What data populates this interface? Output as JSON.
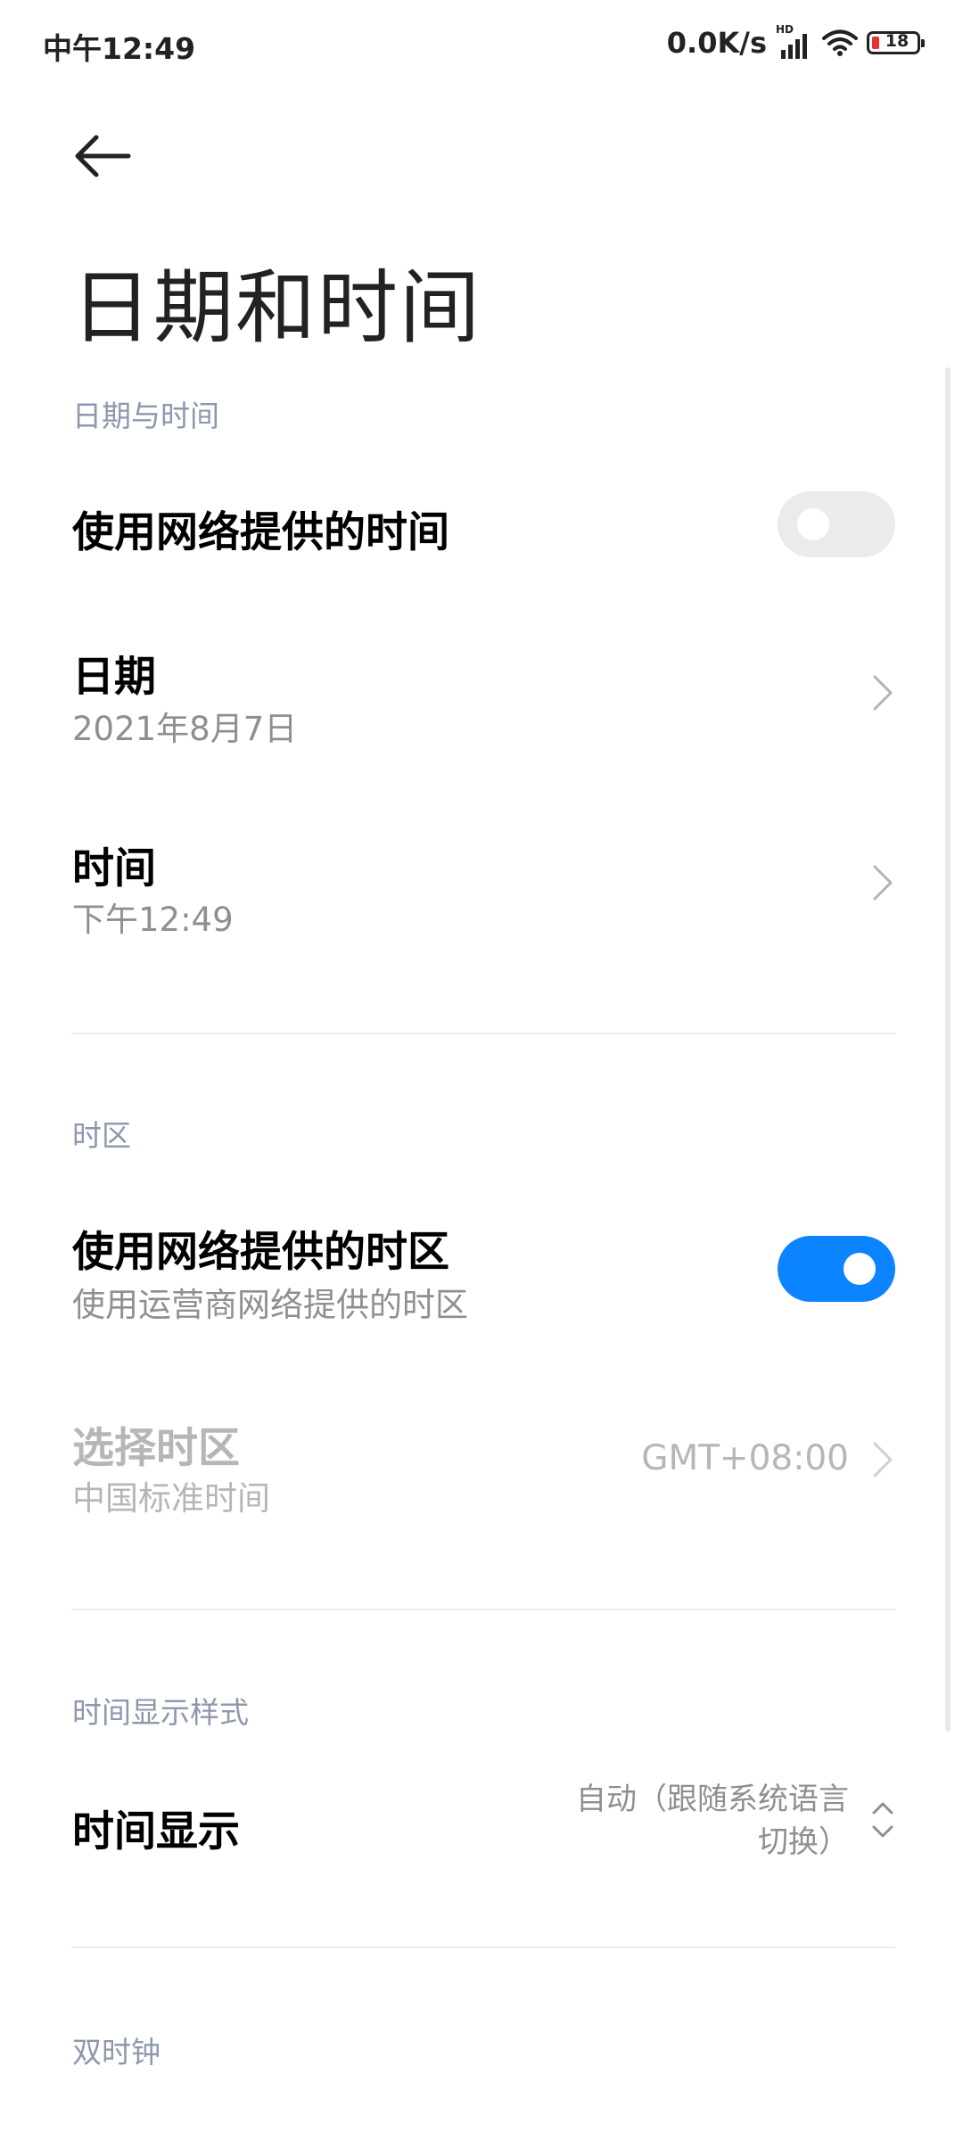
{
  "status_bar": {
    "time": "中午12:49",
    "net_speed": "0.0K/s",
    "hd_badge": "HD",
    "battery_level": "18",
    "icons": [
      "signal-icon",
      "wifi-icon",
      "battery-icon"
    ]
  },
  "header": {
    "back_icon": "back-arrow-icon",
    "title": "日期和时间"
  },
  "sections": {
    "date_time": {
      "header": "日期与时间",
      "network_time": {
        "title": "使用网络提供的时间",
        "enabled": false
      },
      "date": {
        "title": "日期",
        "value": "2021年8月7日"
      },
      "time": {
        "title": "时间",
        "value": "下午12:49"
      }
    },
    "timezone": {
      "header": "时区",
      "network_timezone": {
        "title": "使用网络提供的时区",
        "subtitle": "使用运营商网络提供的时区",
        "enabled": true
      },
      "select_timezone": {
        "title": "选择时区",
        "subtitle": "中国标准时间",
        "value": "GMT+08:00",
        "disabled": true
      }
    },
    "time_format": {
      "header": "时间显示样式",
      "display": {
        "title": "时间显示",
        "value_line1": "自动（跟随系统语言",
        "value_line2": "切换）"
      }
    },
    "dual_clock": {
      "header": "双时钟"
    }
  },
  "colors": {
    "accent": "#0d84ff",
    "section_header": "#8e97ae",
    "secondary_text": "#8f8f8f",
    "disabled_text": "#b6b6b6",
    "toggle_off": "#ebebeb"
  }
}
